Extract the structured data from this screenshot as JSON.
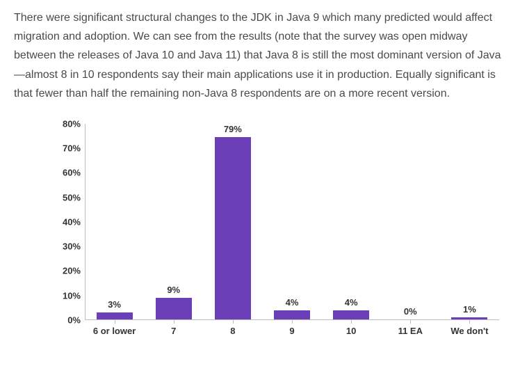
{
  "paragraph": "There were significant structural changes to the JDK in Java 9 which many predicted would affect migration and adoption. We can see from the results (note that the survey was open midway between the releases of Java 10 and Java 11) that Java 8 is still the most dominant version of Java—almost 8 in 10 respondents say their main applications use it in production. Equally significant is that fewer than half the remaining non-Java 8 respondents are on a more recent version.",
  "chart_data": {
    "type": "bar",
    "categories": [
      "6 or lower",
      "7",
      "8",
      "9",
      "10",
      "11 EA",
      "We don't"
    ],
    "values": [
      3,
      9,
      79,
      4,
      4,
      0,
      1
    ],
    "value_labels": [
      "3%",
      "9%",
      "79%",
      "4%",
      "4%",
      "0%",
      "1%"
    ],
    "y_ticks": [
      0,
      10,
      20,
      30,
      40,
      50,
      60,
      70,
      80
    ],
    "y_tick_labels": [
      "0%",
      "10%",
      "20%",
      "30%",
      "40%",
      "50%",
      "60%",
      "70%",
      "80%"
    ],
    "ylim": [
      0,
      80
    ],
    "title": "",
    "xlabel": "",
    "ylabel": "",
    "bar_color": "#6b3fb8"
  }
}
